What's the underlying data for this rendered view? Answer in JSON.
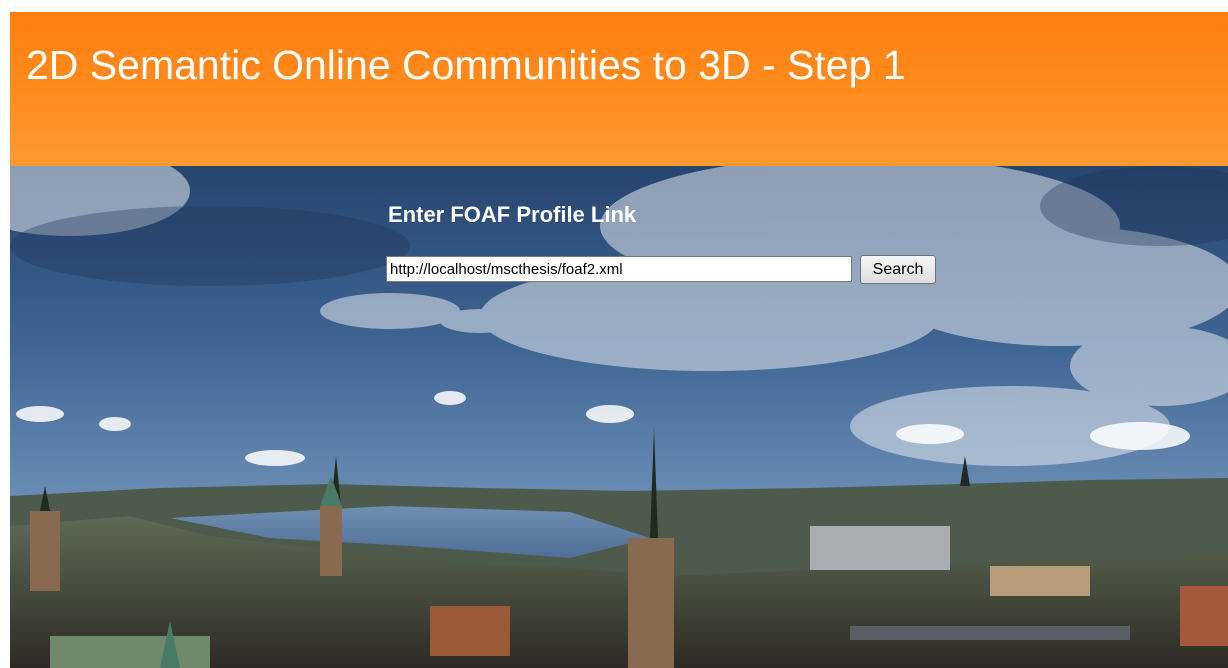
{
  "header": {
    "title": "2D Semantic Online Communities to 3D - Step 1"
  },
  "form": {
    "heading": "Enter FOAF Profile Link",
    "url_value": "http://localhost/mscthesis/foaf2.xml",
    "search_label": "Search"
  },
  "colors": {
    "header_orange": "#ff8c1f",
    "text_white": "#ffffff"
  }
}
